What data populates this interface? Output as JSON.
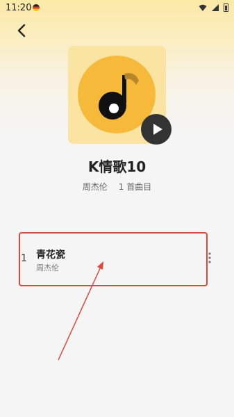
{
  "status_bar": {
    "time": "11:20"
  },
  "playlist": {
    "title": "K情歌10",
    "artist": "周杰伦",
    "count_label": "1 首曲目"
  },
  "songs": [
    {
      "index": "1",
      "title": "青花瓷",
      "artist": "周杰伦"
    }
  ],
  "colors": {
    "accent": "#f6b93a",
    "highlight_box": "#e0463a",
    "play_button": "#333333"
  },
  "icons": [
    "back-arrow-icon",
    "play-icon",
    "more-vertical-icon",
    "wifi-icon",
    "signal-icon",
    "battery-icon"
  ]
}
